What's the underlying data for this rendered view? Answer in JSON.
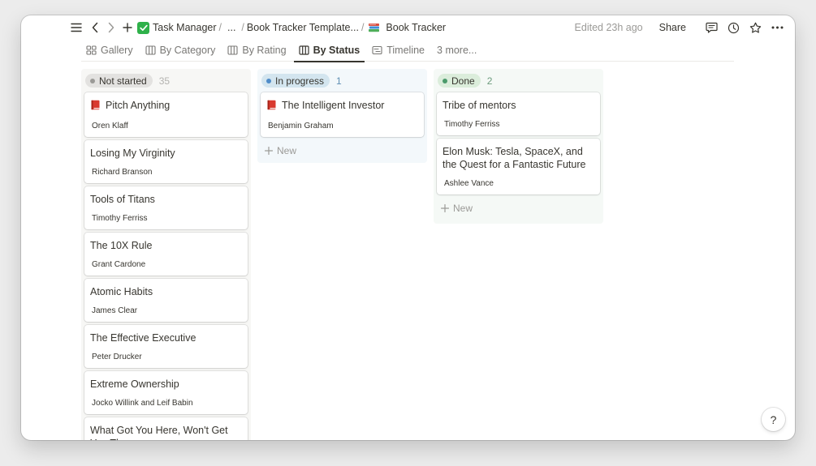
{
  "breadcrumb": {
    "workspace": "Task Manager",
    "ellipsis": "...",
    "template": "Book Tracker Template...",
    "page": "Book Tracker",
    "sep": "/"
  },
  "topbar": {
    "edited": "Edited 23h ago",
    "share": "Share"
  },
  "views": {
    "tabs": [
      {
        "label": "Gallery",
        "icon": "gallery-icon",
        "active": false
      },
      {
        "label": "By Category",
        "icon": "board-icon",
        "active": false
      },
      {
        "label": "By Rating",
        "icon": "board-icon",
        "active": false
      },
      {
        "label": "By Status",
        "icon": "board-icon",
        "active": true
      },
      {
        "label": "Timeline",
        "icon": "timeline-icon",
        "active": false
      }
    ],
    "more": "3 more..."
  },
  "columns": [
    {
      "name": "Not started",
      "count": "35",
      "color": "#9b9a97",
      "bg": "#f7f7f5",
      "pill_bg": "#e3e2e0",
      "count_color": "#b4b3b0",
      "cards": [
        {
          "title": "Pitch Anything",
          "author": "Oren Klaff",
          "book": true
        },
        {
          "title": "Losing My Virginity",
          "author": "Richard Branson",
          "book": false
        },
        {
          "title": "Tools of Titans",
          "author": "Timothy Ferriss",
          "book": false
        },
        {
          "title": "The 10X Rule",
          "author": "Grant Cardone",
          "book": false
        },
        {
          "title": "Atomic Habits",
          "author": "James Clear",
          "book": false
        },
        {
          "title": "The Effective Executive",
          "author": "Peter Drucker",
          "book": false
        },
        {
          "title": "Extreme Ownership",
          "author": "Jocko Willink and Leif Babin",
          "book": false
        },
        {
          "title": "What Got You Here, Won't Get You There",
          "author": "",
          "book": false
        }
      ]
    },
    {
      "name": "In progress",
      "count": "1",
      "color": "#4f8cc9",
      "bg": "#f3f8fb",
      "pill_bg": "#d3e5ef",
      "count_color": "#5f8fb4",
      "new_label": "New",
      "cards": [
        {
          "title": "The Intelligent Investor",
          "author": "Benjamin Graham",
          "book": true
        }
      ]
    },
    {
      "name": "Done",
      "count": "2",
      "color": "#4b9a6b",
      "bg": "#f5f9f6",
      "pill_bg": "#dbeddb",
      "count_color": "#6c9b7d",
      "new_label": "New",
      "cards": [
        {
          "title": "Tribe of mentors",
          "author": "Timothy Ferriss",
          "book": false
        },
        {
          "title": "Elon Musk: Tesla, SpaceX, and the Quest for a Fantastic Future",
          "author": "Ashlee Vance",
          "book": false
        }
      ]
    }
  ],
  "help": "?"
}
